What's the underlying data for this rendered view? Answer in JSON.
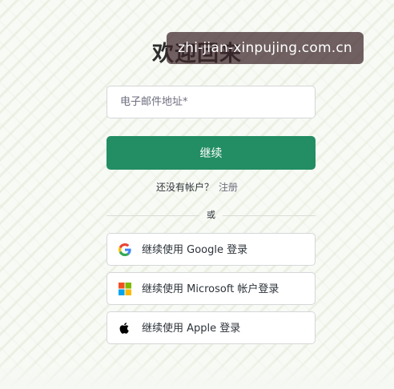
{
  "title": "欢迎回来",
  "watermark": "zhi-jian-xinpujing.com.cn",
  "email": {
    "placeholder": "电子邮件地址*",
    "value": ""
  },
  "continue_label": "继续",
  "signup": {
    "question": "还没有帐户？",
    "link": "注册"
  },
  "divider_text": "或",
  "social": [
    {
      "icon": "google-icon",
      "label": "继续使用 Google 登录"
    },
    {
      "icon": "microsoft-icon",
      "label": "继续使用 Microsoft 帐户登录"
    },
    {
      "icon": "apple-icon",
      "label": "继续使用 Apple 登录"
    }
  ],
  "colors": {
    "primary": "#238d63",
    "background": "#f8faf5",
    "border": "#d4d6d9"
  }
}
